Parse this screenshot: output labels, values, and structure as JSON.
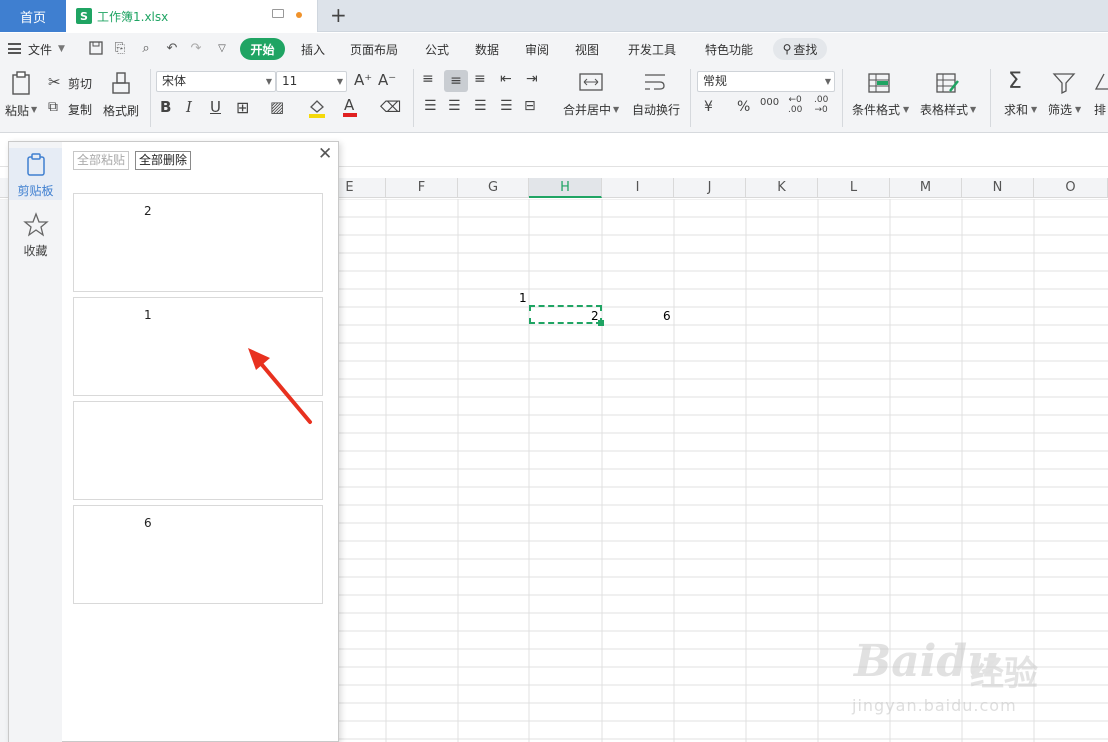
{
  "titlebar": {
    "home_tab": "首页",
    "doc_logo": "S",
    "doc_title": "工作簿1.xlsx",
    "add_tab": "+"
  },
  "menu": {
    "file": "文件",
    "items": [
      "开始",
      "插入",
      "页面布局",
      "公式",
      "数据",
      "审阅",
      "视图",
      "开发工具",
      "特色功能"
    ],
    "search": "查找"
  },
  "ribbon": {
    "paste": "粘贴",
    "cut": "剪切",
    "copy": "复制",
    "format_painter": "格式刷",
    "font_name": "宋体",
    "font_size": "11",
    "merge_center": "合并居中",
    "wrap_text": "自动换行",
    "number_format": "常规",
    "conditional_format": "条件格式",
    "table_style": "表格样式",
    "sum": "求和",
    "filter": "筛选",
    "sort": "排"
  },
  "columns": [
    "E",
    "F",
    "G",
    "H",
    "I",
    "J",
    "K",
    "L",
    "M",
    "N",
    "O"
  ],
  "active_column": "H",
  "cells": {
    "g_value": "1",
    "h_value": "2",
    "i_value": "6"
  },
  "clipboard": {
    "tab_clipboard": "剪贴板",
    "tab_favorites": "收藏",
    "paste_all": "全部粘贴",
    "delete_all": "全部删除",
    "items": [
      "2",
      "1",
      "",
      "6"
    ]
  },
  "watermark": {
    "brand": "Baidu",
    "brand_cn": "经验",
    "url": "jingyan.baidu.com"
  },
  "colors": {
    "accent_green": "#1fa463",
    "home_tab_blue": "#3f7fd0",
    "arrow_red": "#e8311f"
  }
}
